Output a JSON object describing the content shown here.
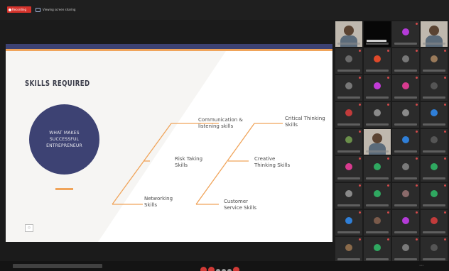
{
  "topbar": {
    "recording_label": "Recording",
    "share_label": "Viewing screen sharing"
  },
  "slide": {
    "title": "SKILLS REQUIRED",
    "center_text": "WHAT MAKES SUCCESSFUL ENTREPRENEUR",
    "skills": [
      "Communication & listening skills",
      "Critical Thinking Skills",
      "Risk Taking Skills",
      "Creative Thinking Skills",
      "Networking Skills",
      "Customer Service Skills"
    ],
    "colors": {
      "navy": "#3d4273",
      "orange": "#f0a45a",
      "background": "#f6f5f3"
    }
  },
  "participants": {
    "tiles": [
      {
        "type": "video"
      },
      {
        "type": "black"
      },
      {
        "type": "avatar",
        "color": "#b43bd8"
      },
      {
        "type": "video"
      },
      {
        "type": "avatar",
        "color": "#6a6a6a"
      },
      {
        "type": "avatar",
        "color": "#e0492a"
      },
      {
        "type": "avatar",
        "color": "#777777"
      },
      {
        "type": "avatar",
        "color": "#9a7a5a"
      },
      {
        "type": "avatar",
        "color": "#777777"
      },
      {
        "type": "avatar",
        "color": "#c33bd8"
      },
      {
        "type": "avatar",
        "color": "#d83b8f"
      },
      {
        "type": "avatar",
        "color": "#555555"
      },
      {
        "type": "avatar",
        "color": "#c23b3b"
      },
      {
        "type": "avatar",
        "color": "#8a8a8a"
      },
      {
        "type": "avatar",
        "color": "#8a8a8a"
      },
      {
        "type": "avatar",
        "color": "#2f7fd8"
      },
      {
        "type": "avatar",
        "color": "#6a8f4a"
      },
      {
        "type": "video"
      },
      {
        "type": "avatar",
        "color": "#2f7fd8"
      },
      {
        "type": "avatar",
        "color": "#555555"
      },
      {
        "type": "avatar",
        "color": "#d83b8f"
      },
      {
        "type": "avatar",
        "color": "#2fa860"
      },
      {
        "type": "avatar",
        "color": "#7a7a7a"
      },
      {
        "type": "avatar",
        "color": "#2fa860"
      },
      {
        "type": "avatar",
        "color": "#8a8a8a"
      },
      {
        "type": "avatar",
        "color": "#2fa860"
      },
      {
        "type": "avatar",
        "color": "#8a6a6a"
      },
      {
        "type": "avatar",
        "color": "#2fa860"
      },
      {
        "type": "avatar",
        "color": "#2f7fd8"
      },
      {
        "type": "avatar",
        "color": "#7a5a4a"
      },
      {
        "type": "avatar",
        "color": "#b43bd8"
      },
      {
        "type": "avatar",
        "color": "#c23b3b"
      },
      {
        "type": "avatar",
        "color": "#8a6a4a"
      },
      {
        "type": "avatar",
        "color": "#2fa860"
      },
      {
        "type": "avatar",
        "color": "#7a7a7a"
      },
      {
        "type": "avatar",
        "color": "#555555"
      }
    ]
  }
}
